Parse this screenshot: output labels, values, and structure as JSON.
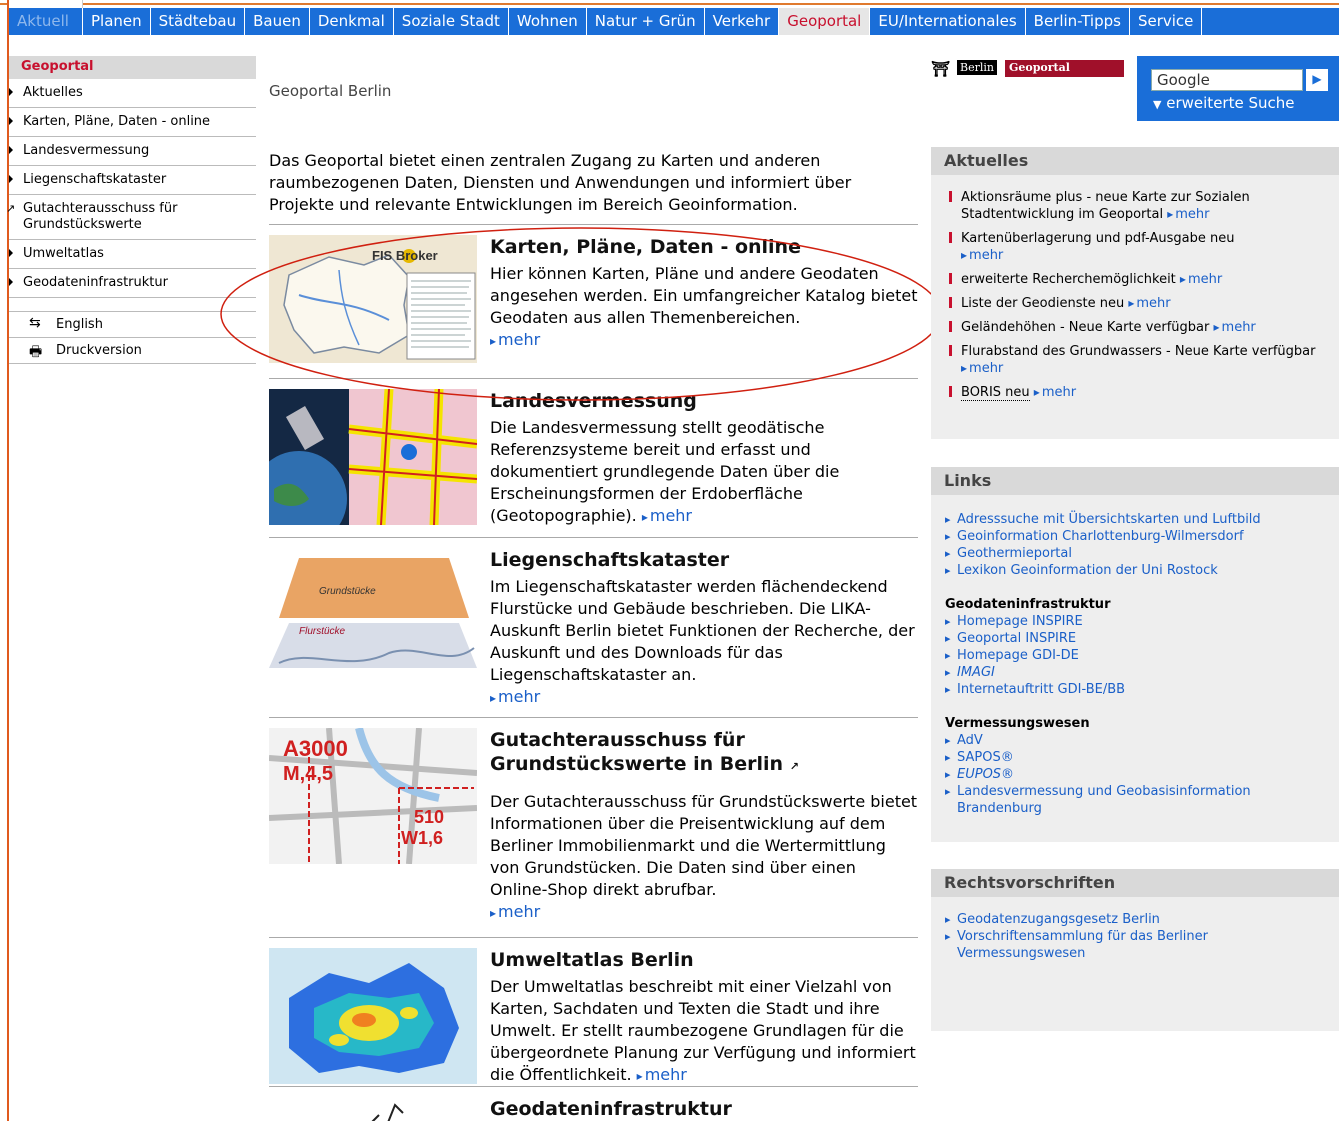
{
  "nav": {
    "items": [
      "Aktuell",
      "Planen",
      "Städtebau",
      "Bauen",
      "Denkmal",
      "Soziale Stadt",
      "Wohnen",
      "Natur + Grün",
      "Verkehr",
      "Geoportal",
      "EU/Internationales",
      "Berlin-Tipps",
      "Service"
    ],
    "active": "Geoportal"
  },
  "sidebar": {
    "title": "Geoportal",
    "items": [
      {
        "label": "Aktuelles"
      },
      {
        "label": "Karten, Pläne, Daten - online"
      },
      {
        "label": "Landesvermessung"
      },
      {
        "label": "Liegenschaftskataster"
      },
      {
        "label": "Gutachterausschuss für Grundstückswerte"
      },
      {
        "label": "Umweltatlas"
      },
      {
        "label": "Geodateninfrastruktur"
      }
    ],
    "english": "English",
    "print": "Druckversion"
  },
  "main": {
    "title": "Geoportal Berlin",
    "intro": "Das Geoportal bietet einen zentralen Zugang zu Karten und anderen raumbezogenen Daten, Diensten und Anwendungen und informiert über Projekte und relevante Entwicklungen im Bereich Geoinformation.",
    "more": "mehr",
    "sections": [
      {
        "title": "Karten, Pläne, Daten - online",
        "text": "Hier können Karten, Pläne und andere Geodaten angesehen werden. Ein umfangreicher Katalog bietet Geodaten aus allen Themenbereichen.",
        "thumb_label": "FIS Broker"
      },
      {
        "title": "Landesvermessung",
        "text": "Die Landesvermessung stellt geodätische Referenzsysteme bereit und erfasst und dokumentiert grundlegende Daten über die Erscheinungsformen der Erdoberfläche (Geotopographie)."
      },
      {
        "title": "Liegenschaftskataster",
        "text": "Im Liegenschaftskataster werden flächendeckend Flurstücke und Gebäude beschrieben. Die LIKA-Auskunft Berlin bietet Funktionen der Recherche, der Auskunft und des Downloads für das Liegenschaftskataster an.",
        "thumb_label_top": "Grundstücke",
        "thumb_label_bottom": "Flurstücke"
      },
      {
        "title": "Gutachterausschuss für Grundstückswerte in Berlin",
        "text": "Der Gutachterausschuss für Grundstückswerte bietet Informationen über die Preisentwicklung auf dem Berliner Immobilienmarkt und die Wertermittlung von Grundstücken. Die Daten sind über einen Online-Shop direkt abrufbar.",
        "thumb_a": "A3000",
        "thumb_b": "M,4,5",
        "thumc_c": "",
        "thumb_c": "510",
        "thumb_d": "W1,6"
      },
      {
        "title": "Umweltatlas Berlin",
        "text": "Der Umweltatlas beschreibt mit einer Vielzahl von Karten, Sachdaten und Texten die Stadt und ihre Umwelt. Er stellt raumbezogene Grundlagen für die übergeordnete Planung zur Verfügung und informiert die Öffentlichkeit."
      },
      {
        "title": "Geodateninfrastruktur"
      }
    ]
  },
  "right": {
    "logo_berlin": "Berlin",
    "logo_geo": "Geoportal",
    "search_value": "Google",
    "search_adv": "erweiterte Suche",
    "aktuelles_title": "Aktuelles",
    "news": [
      {
        "text": "Aktionsräume plus - neue Karte zur Sozialen Stadtentwicklung im Geoportal"
      },
      {
        "text": "Kartenüberlagerung und pdf-Ausgabe neu"
      },
      {
        "text": "erweiterte Recherchemöglichkeit"
      },
      {
        "text": "Liste der Geodienste neu"
      },
      {
        "text": "Geländehöhen - Neue Karte verfügbar"
      },
      {
        "text": "Flurabstand des Grundwassers - Neue Karte verfügbar"
      },
      {
        "text": "BORIS neu"
      }
    ],
    "links_title": "Links",
    "links": [
      "Adresssuche mit Übersichtskarten und Luftbild",
      "Geoinformation Charlottenburg-Wilmersdorf",
      "Geothermieportal",
      "Lexikon Geoinformation der Uni Rostock"
    ],
    "gdi_title": "Geodateninfrastruktur",
    "gdi_links": [
      "Homepage INSPIRE",
      "Geoportal INSPIRE",
      "Homepage GDI-DE",
      "IMAGI",
      "Internetauftritt GDI-BE/BB"
    ],
    "verm_title": "Vermessungswesen",
    "verm_links": [
      "AdV",
      "SAPOS®",
      "EUPOS®",
      "Landesvermessung und Geobasisinformation Brandenburg"
    ],
    "recht_title": "Rechtsvorschriften",
    "recht_links": [
      "Geodatenzugangsgesetz Berlin",
      "Vorschriftensammlung für das Berliner Vermessungswesen"
    ]
  },
  "colors": {
    "nav_bg": "#1a6ed8",
    "accent_red": "#c8102e",
    "link": "#1a5fc8",
    "annotation": "#d02010"
  }
}
